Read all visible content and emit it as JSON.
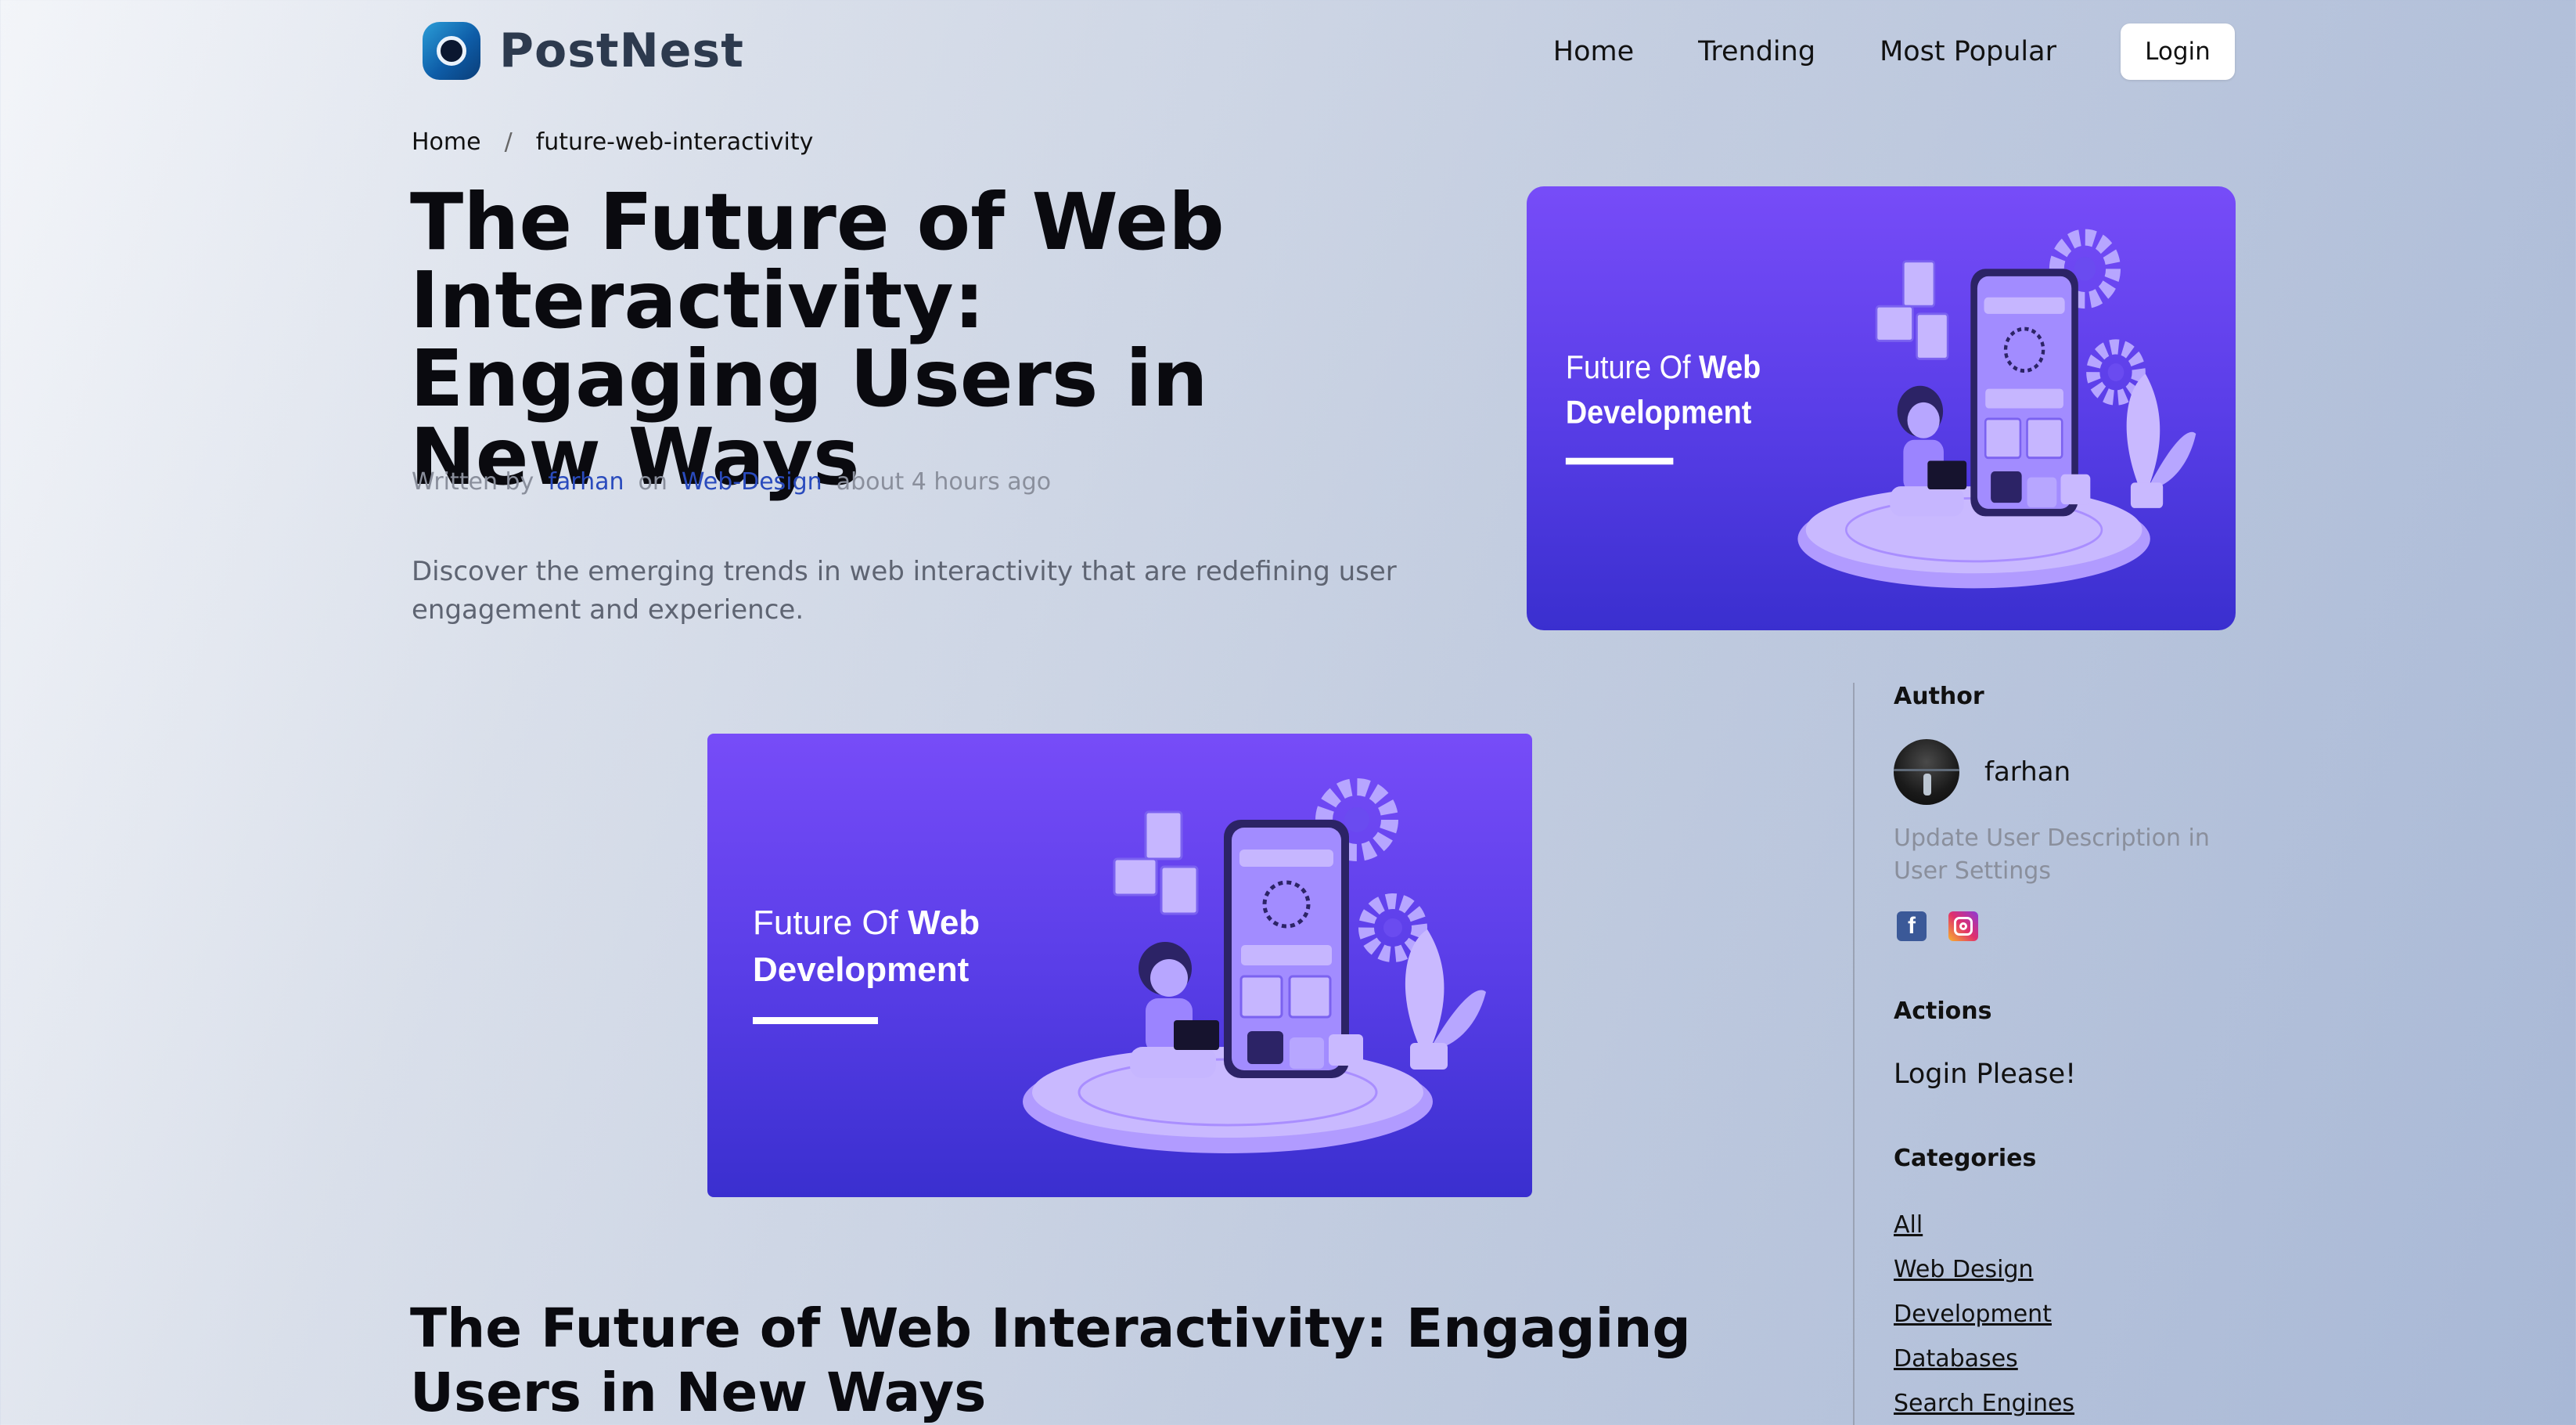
{
  "brand": {
    "name": "PostNest"
  },
  "nav": {
    "items": [
      "Home",
      "Trending",
      "Most Popular"
    ],
    "login_label": "Login"
  },
  "breadcrumb": {
    "home": "Home",
    "separator": "/",
    "current": "future-web-interactivity"
  },
  "post": {
    "title": "The Future of Web Interactivity: Engaging Users in New Ways",
    "written_by": "Written by",
    "author": "farhan",
    "on": "on",
    "category": "Web-Design",
    "time": "about 4 hours ago",
    "summary": "Discover the emerging trends in web interactivity that are redefining user engagement and experience."
  },
  "illustration": {
    "line1_light": "Future Of",
    "line1_bold": "Web",
    "line2_bold": "Development"
  },
  "article": {
    "heading": "The Future of Web Interactivity: Engaging Users in New Ways"
  },
  "sidebar": {
    "author_heading": "Author",
    "author_name": "farhan",
    "author_description": "Update User Description in User Settings",
    "actions_heading": "Actions",
    "action_login": "Login Please!",
    "categories_heading": "Categories",
    "categories": [
      "All",
      "Web Design",
      "Development",
      "Databases",
      "Search Engines"
    ]
  },
  "colors": {
    "accent_link": "#2a4bbd",
    "illustration_top": "#774cf8",
    "illustration_bottom": "#3a2fcf"
  },
  "icons": {
    "logo": "postnest-logo-icon",
    "facebook": "facebook-icon",
    "instagram": "instagram-icon"
  }
}
